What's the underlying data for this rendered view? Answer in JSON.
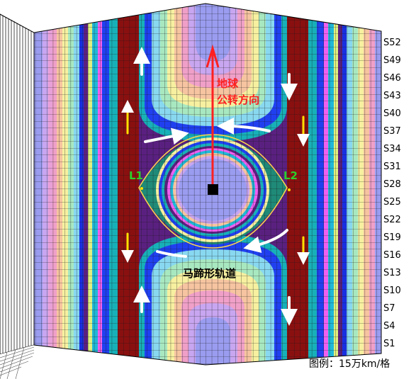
{
  "labels": {
    "direction_line1": "地球",
    "direction_line2": "公转方向",
    "l1": "L1",
    "l2": "L2",
    "orbit": "马蹄形轨道",
    "scale": "图例：15万km/格"
  },
  "axis_ticks": [
    "S52",
    "S49",
    "S46",
    "S43",
    "S40",
    "S37",
    "S34",
    "S31",
    "S28",
    "S25",
    "S22",
    "S19",
    "S16",
    "S13",
    "S10",
    "S7",
    "S4",
    "S1"
  ],
  "colors": {
    "flow_arrow": "#ffffff",
    "l_arrow": "#ffe000",
    "direction_arrow": "#ff2020",
    "lagrange_label": "#2bd12b",
    "earth_marker": "#000000",
    "band_palette": [
      "#9a9cf0",
      "#c8a6f0",
      "#f0a0c8",
      "#f6c4a0",
      "#f6f0a0",
      "#a8e8c0",
      "#88d8f0",
      "#2040f0",
      "#18b0b8",
      "#8a1010",
      "#5a2080",
      "#20b8d8",
      "#e0f080",
      "#f060f0"
    ]
  }
}
